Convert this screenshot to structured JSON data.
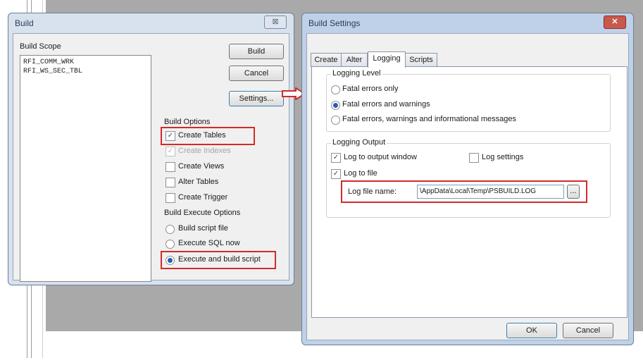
{
  "build_dialog": {
    "title": "Build",
    "close_glyph": "⊠",
    "scope_label": "Build Scope",
    "scope_items": [
      "RFI_COMM_WRK",
      "RFI_WS_SEC_TBL"
    ],
    "build_button": "Build",
    "cancel_button": "Cancel",
    "settings_button": "Settings...",
    "options_label": "Build Options",
    "options": [
      {
        "label": "Create Tables",
        "checked": "✓"
      },
      {
        "label": "Create Indexes",
        "checked": "✓"
      },
      {
        "label": "Create Views",
        "checked": ""
      },
      {
        "label": "Alter Tables",
        "checked": ""
      },
      {
        "label": "Create Trigger",
        "checked": ""
      }
    ],
    "execute_label": "Build Execute Options",
    "execute_options": [
      {
        "label": "Build script file"
      },
      {
        "label": "Execute SQL now"
      },
      {
        "label": "Execute and build script"
      }
    ]
  },
  "settings_dialog": {
    "title": "Build Settings",
    "close_glyph": "✕",
    "tabs": [
      "Create",
      "Alter",
      "Logging",
      "Scripts"
    ],
    "logging_level_label": "Logging Level",
    "levels": [
      {
        "label": "Fatal errors only"
      },
      {
        "label": "Fatal errors and warnings"
      },
      {
        "label": "Fatal errors, warnings and informational messages"
      }
    ],
    "logging_output_label": "Logging Output",
    "log_output_window": "Log to output window",
    "log_settings": "Log settings",
    "log_to_file": "Log to file",
    "check_glyph": "✓",
    "log_file_name_label": "Log file name:",
    "log_file_name_value": "\\AppData\\Local\\Temp\\PSBUILD.LOG",
    "browse_button": "...",
    "ok_button": "OK",
    "cancel_button": "Cancel"
  },
  "colors": {
    "highlight": "#d22a2a",
    "window_frame": "#bfd1e8"
  }
}
